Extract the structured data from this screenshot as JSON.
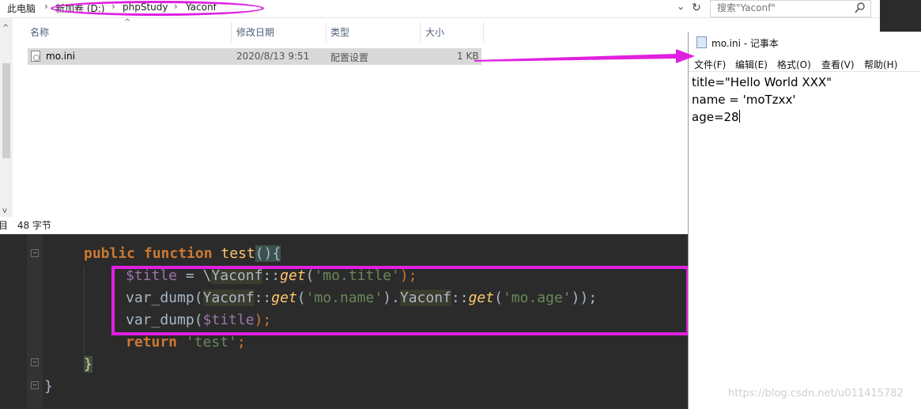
{
  "explorer": {
    "breadcrumb": [
      "此电脑",
      "新加卷 (D:)",
      "phpStudy",
      "Yaconf"
    ],
    "search_placeholder": "搜索\"Yaconf\"",
    "columns": [
      "名称",
      "修改日期",
      "类型",
      "大小"
    ],
    "files": [
      {
        "name": "mo.ini",
        "modified": "2020/8/13 9:51",
        "type": "配置设置",
        "size": "1 KB"
      }
    ],
    "status_prefix": "项目",
    "status_size": "48 字节"
  },
  "notepad": {
    "title": "mo.ini - 记事本",
    "menu": [
      "文件(F)",
      "编辑(E)",
      "格式(O)",
      "查看(V)",
      "帮助(H)"
    ],
    "lines": [
      "title=\"Hello World XXX\"",
      "name = 'moTzxx'",
      "age=28"
    ]
  },
  "editor": {
    "line1": {
      "kw1": "public",
      "kw2": "function",
      "name": "test",
      "parens": "()",
      "brace": "{"
    },
    "line2": {
      "var": "$title",
      "eq": " = \\",
      "cls": "Yaconf",
      "colon": "::",
      "method": "get",
      "open": "(",
      "arg": "'mo.title'",
      "close": ");"
    },
    "line3": {
      "fn": "var_dump(",
      "cls1": "Yaconf",
      "c1": "::",
      "m1": "get",
      "o1": "(",
      "a1": "'mo.name'",
      "dot": ").",
      "cls2": "Yaconf",
      "c2": "::",
      "m2": "get",
      "o2": "(",
      "a2": "'mo.age'",
      "close": "));"
    },
    "line4": {
      "fn": "var_dump(",
      "var": "$title",
      "close": ");"
    },
    "line5": {
      "kw": "return",
      "str": "'test'",
      "semi": ";"
    },
    "line6": {
      "brace": "}"
    },
    "line7": {
      "brace": "}"
    }
  },
  "watermark": "https://blog.csdn.net/u011415782",
  "colors": {
    "annotation": "#e020e0"
  }
}
